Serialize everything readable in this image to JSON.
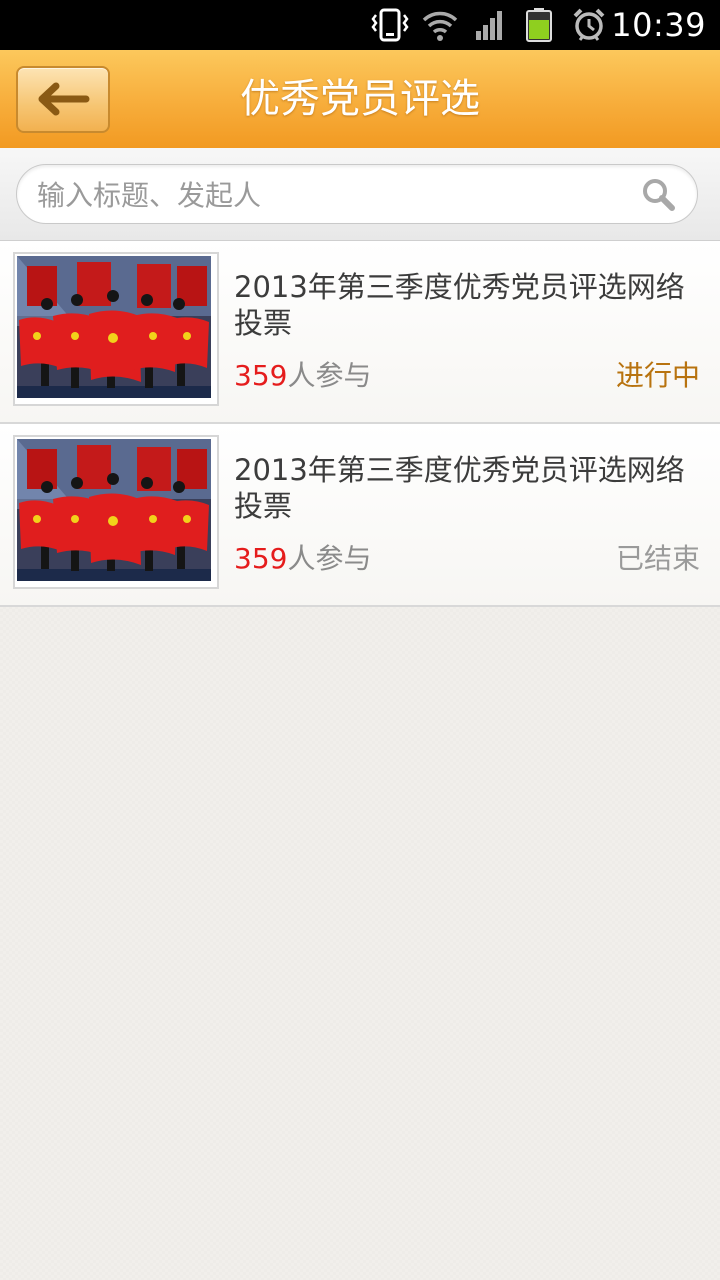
{
  "status_bar": {
    "time": "10:39"
  },
  "header": {
    "title": "优秀党员评选"
  },
  "search": {
    "placeholder": "输入标题、发起人"
  },
  "polls": [
    {
      "title": "2013年第三季度优秀党员评选网络投票",
      "count": "359",
      "count_suffix": "人参与",
      "status": "进行中",
      "status_color": "#b8730f"
    },
    {
      "title": "2013年第三季度优秀党员评选网络投票",
      "count": "359",
      "count_suffix": "人参与",
      "status": "已结束",
      "status_color": "#9a9a9a"
    }
  ],
  "colors": {
    "header_orange": "#f7ad3b",
    "count_red": "#e51c1c",
    "active_status": "#b8730f",
    "ended_status": "#9a9a9a"
  }
}
